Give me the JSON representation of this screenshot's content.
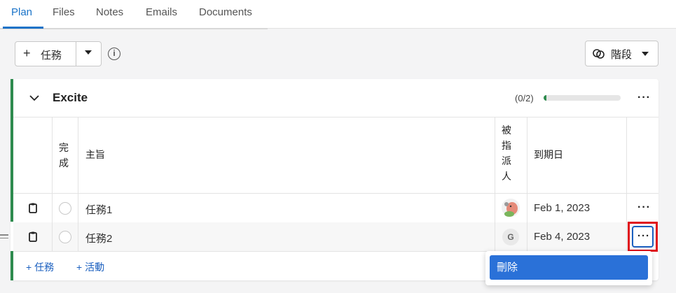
{
  "tabs": [
    {
      "label": "Plan",
      "active": true
    },
    {
      "label": "Files",
      "active": false
    },
    {
      "label": "Notes",
      "active": false
    },
    {
      "label": "Emails",
      "active": false
    },
    {
      "label": "Documents",
      "active": false
    }
  ],
  "toolbar": {
    "add_task_label": "任務",
    "stage_label": "階段"
  },
  "group": {
    "title": "Excite",
    "count": "(0/2)",
    "progress_fraction": 0.04,
    "accent_color": "#2e8b4e"
  },
  "table": {
    "headers": {
      "done": "完\n成",
      "subject": "主旨",
      "assignee": "被\n指\n派\n人",
      "due": "到期日"
    },
    "rows": [
      {
        "subject": "任務1",
        "assignee_initial": "",
        "assignee_icon": "avatar-cartoon",
        "due": "Feb 1, 2023"
      },
      {
        "subject": "任務2",
        "assignee_initial": "G",
        "assignee_icon": "avatar-initial",
        "due": "Feb 4, 2023"
      }
    ]
  },
  "footer": {
    "add_task": "任務",
    "add_activity": "活動"
  },
  "menu": {
    "items": [
      "刪除"
    ]
  },
  "colors": {
    "brand_blue": "#1a73c8",
    "highlight_red": "#e0101a",
    "menu_blue": "#2a71d8"
  }
}
